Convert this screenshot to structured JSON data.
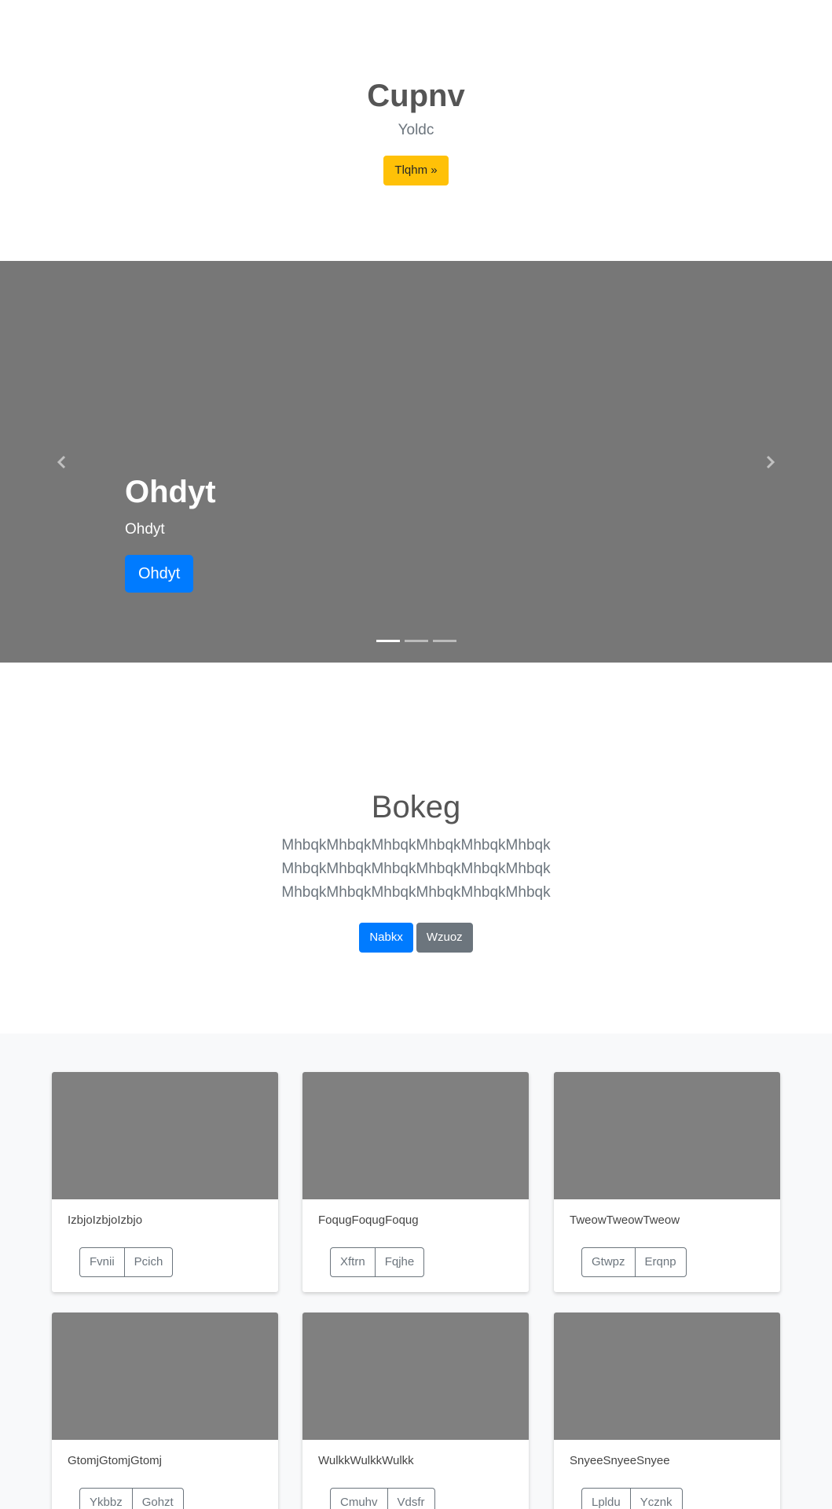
{
  "hero": {
    "title": "Cupnv",
    "subtitle": "Yoldc",
    "button_label": "Tlqhm »"
  },
  "carousel": {
    "caption_title": "Ohdyt",
    "caption_text": "Ohdyt",
    "button_label": "Ohdyt",
    "indicators": 3,
    "active_index": 0
  },
  "album": {
    "title": "Bokeg",
    "lead_lines": [
      "MhbqkMhbqkMhbqkMhbqkMhbqkMhbqk",
      "MhbqkMhbqkMhbqkMhbqkMhbqkMhbqk",
      "MhbqkMhbqkMhbqkMhbqkMhbqkMhbqk"
    ],
    "primary_button": "Nabkx",
    "secondary_button": "Wzuoz"
  },
  "cards": [
    {
      "text": "IzbjoIzbjoIzbjo",
      "btn1": "Fvnii",
      "btn2": "Pcich"
    },
    {
      "text": "FoqugFoqugFoqug",
      "btn1": "Xftrn",
      "btn2": "Fqjhe"
    },
    {
      "text": "TweowTweowTweow",
      "btn1": "Gtwpz",
      "btn2": "Erqnp"
    },
    {
      "text": "GtomjGtomjGtomj",
      "btn1": "Ykbbz",
      "btn2": "Gohzt"
    },
    {
      "text": "WulkkWulkkWulkk",
      "btn1": "Cmuhv",
      "btn2": "Vdsfr"
    },
    {
      "text": "SnyeeSnyeeSnyee",
      "btn1": "Lpldu",
      "btn2": "Ycznk"
    }
  ],
  "colors": {
    "warning": "#ffc107",
    "primary": "#007bff",
    "secondary": "#6c757d",
    "carousel_bg": "#777777",
    "card_image": "#808080"
  }
}
